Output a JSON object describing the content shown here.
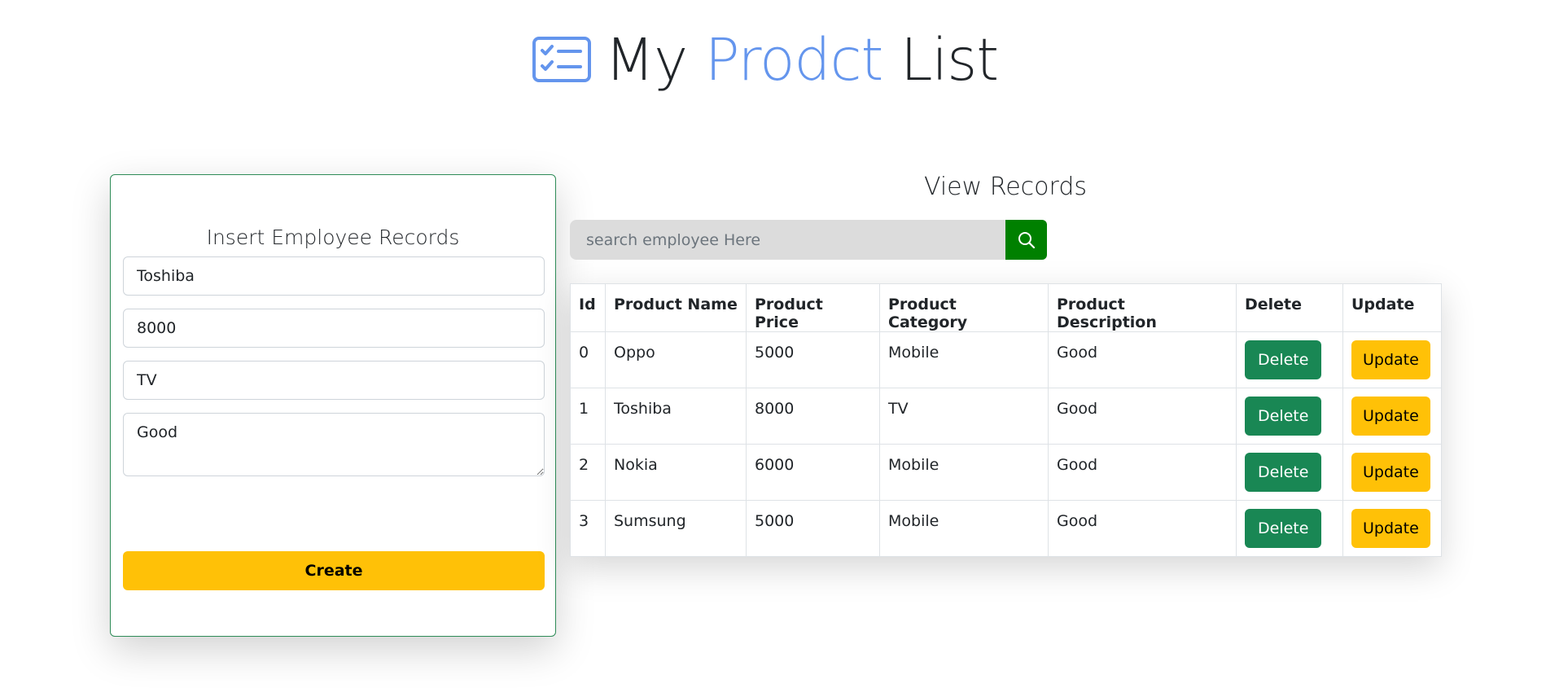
{
  "header": {
    "title_part1": "My",
    "title_accent": "Prodct",
    "title_part2": "List",
    "icon": "task-list-icon",
    "accent_color": "#6495ed"
  },
  "form": {
    "title": "Insert Employee Records",
    "name_value": "Toshiba",
    "price_value": "8000",
    "category_value": "TV",
    "description_value": "Good",
    "create_label": "Create",
    "border_color": "#2e8b57",
    "create_color": "#ffc107"
  },
  "records": {
    "title": "View Records",
    "search": {
      "placeholder": "search employee Here",
      "icon": "search-icon",
      "button_color": "#008000"
    },
    "columns": [
      "Id",
      "Product Name",
      "Product Price",
      "Product Category",
      "Product Description",
      "Delete",
      "Update"
    ],
    "rows": [
      {
        "id": "0",
        "name": "Oppo",
        "price": "5000",
        "category": "Mobile",
        "description": "Good",
        "delete_label": "Delete",
        "update_label": "Update"
      },
      {
        "id": "1",
        "name": "Toshiba",
        "price": "8000",
        "category": "TV",
        "description": "Good",
        "delete_label": "Delete",
        "update_label": "Update"
      },
      {
        "id": "2",
        "name": "Nokia",
        "price": "6000",
        "category": "Mobile",
        "description": "Good",
        "delete_label": "Delete",
        "update_label": "Update"
      },
      {
        "id": "3",
        "name": "Sumsung",
        "price": "5000",
        "category": "Mobile",
        "description": "Good",
        "delete_label": "Delete",
        "update_label": "Update"
      }
    ],
    "delete_color": "#198754",
    "update_color": "#ffc107"
  }
}
